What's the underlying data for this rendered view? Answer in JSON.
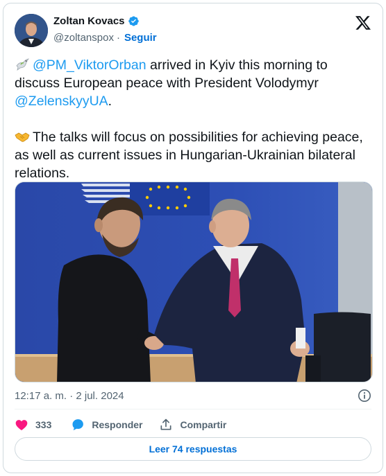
{
  "author": {
    "name": "Zoltan Kovacs",
    "handle": "@zoltanspox",
    "separator": "·",
    "follow_label": "Seguir"
  },
  "tweet": {
    "mention1": "@PM_ViktorOrban",
    "text1": " arrived in Kyiv this morning to discuss European peace with President Volodymyr ",
    "mention2": "@ZelenskyyUA",
    "text1_end": ".",
    "text2": "The talks will focus on possibilities for achieving peace, as well as current issues in Hungarian-Ukrainian bilateral relations."
  },
  "meta": {
    "timestamp": "12:17 a. m. · 2 jul. 2024"
  },
  "actions": {
    "like_count": "333",
    "reply_label": "Responder",
    "share_label": "Compartir"
  },
  "read_replies_label": "Leer 74 respuestas",
  "colors": {
    "accent": "#1d9bf0",
    "link": "#006fd6",
    "like": "#f91880",
    "muted": "#536471"
  },
  "icons": [
    "verified-badge-icon",
    "x-logo-icon",
    "dove-icon",
    "handshake-icon",
    "info-icon",
    "heart-icon",
    "reply-bubble-icon",
    "share-icon"
  ]
}
